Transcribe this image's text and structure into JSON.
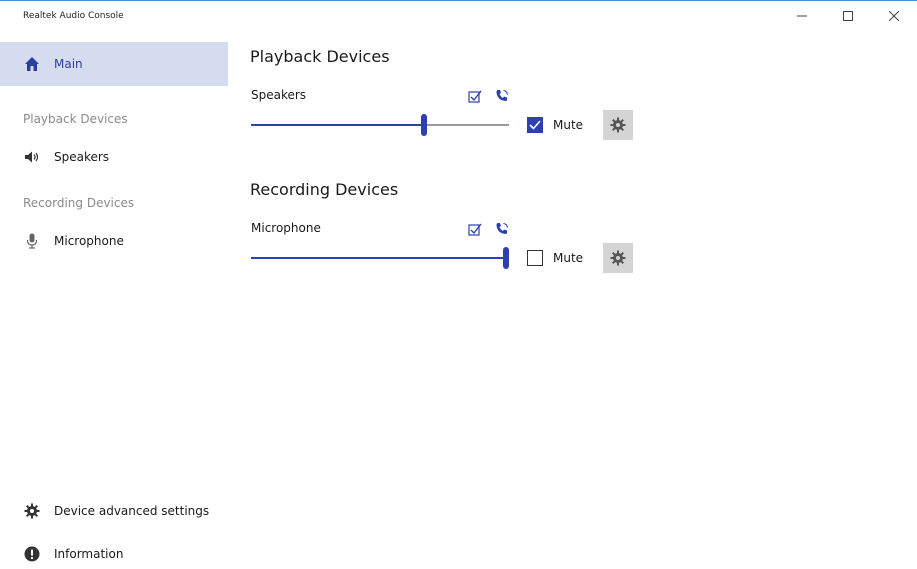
{
  "window": {
    "title": "Realtek Audio Console",
    "controls": [
      "minimize",
      "maximize",
      "close"
    ]
  },
  "sidebar": {
    "main_label": "Main",
    "playback_section": "Playback Devices",
    "playback_items": [
      {
        "label": "Speakers",
        "icon": "speaker-icon"
      }
    ],
    "recording_section": "Recording Devices",
    "recording_items": [
      {
        "label": "Microphone",
        "icon": "microphone-icon"
      }
    ],
    "bottom_items": [
      {
        "label": "Device advanced settings",
        "icon": "gear-icon"
      },
      {
        "label": "Information",
        "icon": "info-icon"
      }
    ]
  },
  "main": {
    "playback": {
      "title": "Playback Devices",
      "device": "Speakers",
      "volume_fraction": 0.67,
      "mute_checked": true,
      "mute_label": "Mute"
    },
    "recording": {
      "title": "Recording Devices",
      "device": "Microphone",
      "volume_fraction": 1.0,
      "mute_checked": false,
      "mute_label": "Mute"
    }
  },
  "colors": {
    "accent": "#2e3fb0",
    "selected_bg": "#d6dcf0",
    "track": "#9a9a9a"
  }
}
